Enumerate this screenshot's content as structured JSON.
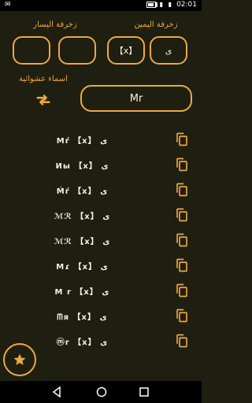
{
  "status": {
    "time": "02:01",
    "signal": "▮▮ ▮"
  },
  "labels": {
    "right_decoration": "زخرفة اليمين",
    "left_decoration": "زخرفة اليسار",
    "random_names": "اسماء عشوائية"
  },
  "decor_boxes": {
    "left_1": "",
    "left_2": "",
    "right_1": "【x】",
    "right_2": "ى"
  },
  "input": {
    "value": "Mr"
  },
  "results": [
    {
      "text": "Mŕ 【x】 ى"
    },
    {
      "text": "Иы 【x】 ى"
    },
    {
      "text": "Ḿŕ 【x】 ى"
    },
    {
      "text": "ℳℛ 【x】 ى"
    },
    {
      "text": "ℳℛ 【x】 ى"
    },
    {
      "text": "Mɾ 【x】 ى"
    },
    {
      "text": "M r 【x】 ى"
    },
    {
      "text": "ᗰя 【x】 ى"
    },
    {
      "text": "ⓜr 【x】 ى"
    }
  ],
  "colors": {
    "accent": "#f0a742",
    "background": "#1e1f10"
  }
}
